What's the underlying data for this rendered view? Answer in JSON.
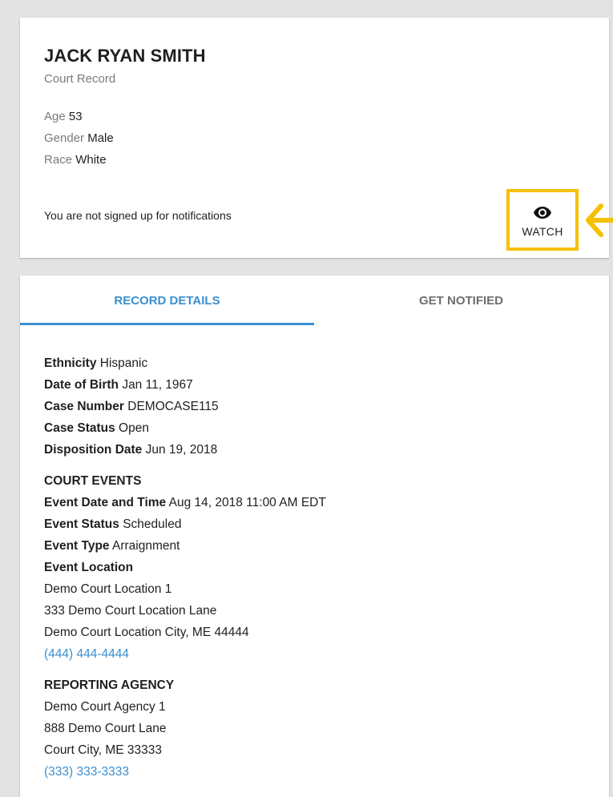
{
  "person": {
    "name": "JACK RYAN SMITH",
    "record_type": "Court Record",
    "age_label": "Age",
    "age": "53",
    "gender_label": "Gender",
    "gender": "Male",
    "race_label": "Race",
    "race": "White"
  },
  "notifications": {
    "status_text": "You are not signed up for notifications",
    "watch_label": "WATCH",
    "highlight_color": "#f5c000"
  },
  "tabs": [
    {
      "label": "RECORD DETAILS",
      "active": true
    },
    {
      "label": "GET NOTIFIED",
      "active": false
    }
  ],
  "record_details": [
    {
      "label": "Ethnicity",
      "value": "Hispanic"
    },
    {
      "label": "Date of Birth",
      "value": "Jan 11, 1967"
    },
    {
      "label": "Case Number",
      "value": "DEMOCASE115"
    },
    {
      "label": "Case Status",
      "value": "Open"
    },
    {
      "label": "Disposition Date",
      "value": "Jun 19, 2018"
    }
  ],
  "court_events": {
    "title": "COURT EVENTS",
    "event_datetime_label": "Event Date and Time",
    "event_datetime": "Aug 14, 2018 11:00 AM EDT",
    "event_status_label": "Event Status",
    "event_status": "Scheduled",
    "event_type_label": "Event Type",
    "event_type": "Arraignment",
    "event_location_label": "Event Location",
    "location_name": "Demo Court Location 1",
    "location_street": "333 Demo Court Location Lane",
    "location_city": "Demo Court Location City, ME 44444",
    "location_phone": "(444) 444-4444"
  },
  "reporting_agency": {
    "title": "REPORTING AGENCY",
    "name": "Demo Court Agency 1",
    "street": "888 Demo Court Lane",
    "city": "Court City, ME 33333",
    "phone": "(333) 333-3333"
  },
  "colors": {
    "accent": "#3a8fd0",
    "background": "#e3e3e3"
  }
}
